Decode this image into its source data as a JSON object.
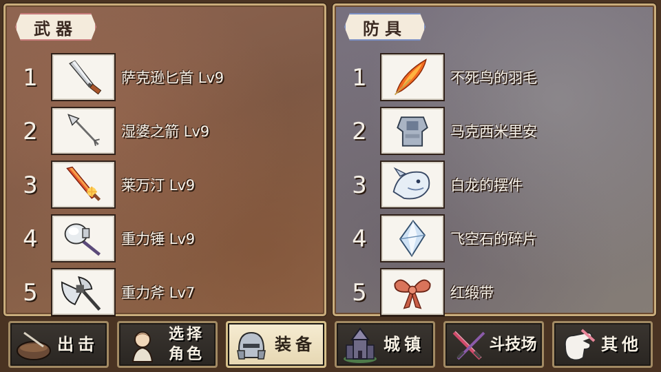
{
  "weapons_panel": {
    "title": "武器",
    "items": [
      {
        "num": "1",
        "name": "萨克逊匕首 Lv9",
        "icon": "dagger-icon"
      },
      {
        "num": "2",
        "name": "湿婆之箭 Lv9",
        "icon": "arrow-icon"
      },
      {
        "num": "3",
        "name": "莱万汀 Lv9",
        "icon": "flame-sword-icon"
      },
      {
        "num": "4",
        "name": "重力锤 Lv9",
        "icon": "hammer-icon"
      },
      {
        "num": "5",
        "name": "重力斧 Lv7",
        "icon": "axe-icon"
      }
    ]
  },
  "armor_panel": {
    "title": "防具",
    "items": [
      {
        "num": "1",
        "name": "不死鸟的羽毛",
        "icon": "phoenix-feather-icon"
      },
      {
        "num": "2",
        "name": "马克西米里安",
        "icon": "plate-armor-icon"
      },
      {
        "num": "3",
        "name": "白龙的摆件",
        "icon": "white-dragon-icon"
      },
      {
        "num": "4",
        "name": "飞空石的碎片",
        "icon": "crystal-shard-icon"
      },
      {
        "num": "5",
        "name": "红缎带",
        "icon": "red-ribbon-icon"
      }
    ]
  },
  "nav": {
    "sortie": {
      "label": "出击",
      "icon": "bowl-icon"
    },
    "select_character": {
      "label": "选择\n角色",
      "icon": "character-icon"
    },
    "equipment": {
      "label": "装备",
      "icon": "helmet-icon",
      "active": true
    },
    "town": {
      "label": "城镇",
      "icon": "castle-icon"
    },
    "arena": {
      "label": "斗技场",
      "icon": "crossed-swords-icon"
    },
    "other": {
      "label": "其他",
      "icon": "glove-icon"
    }
  },
  "colors": {
    "weapons_title_border": "#c77b7b",
    "armor_title_border": "#7a8fc4",
    "active_nav_bg": "#f6ecd2"
  }
}
